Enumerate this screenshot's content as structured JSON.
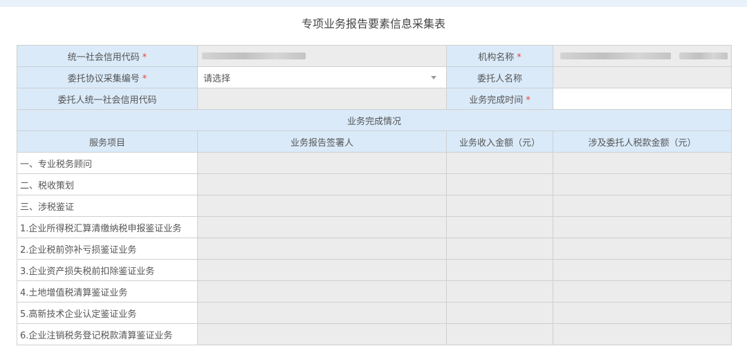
{
  "page": {
    "title": "专项业务报告要素信息采集表"
  },
  "fields": {
    "credit_code_label": "统一社会信用代码",
    "org_name_label": "机构名称",
    "agreement_no_label": "委托协议采集编号",
    "agreement_no_placeholder": "请选择",
    "client_name_label": "委托人名称",
    "client_credit_code_label": "委托人统一社会信用代码",
    "complete_time_label": "业务完成时间",
    "required_mark": "*"
  },
  "section": {
    "title": "业务完成情况"
  },
  "table": {
    "headers": [
      "服务项目",
      "业务报告签署人",
      "业务收入金额（元）",
      "涉及委托人税款金额（元）"
    ],
    "rows": [
      "一、专业税务顾问",
      "二、税收策划",
      "三、涉税鉴证",
      "1.企业所得税汇算清缴纳税申报鉴证业务",
      "2.企业税前弥补亏损鉴证业务",
      "3.企业资产损失税前扣除鉴证业务",
      "4.土地增值税清算鉴证业务",
      "5.高新技术企业认定鉴证业务",
      "6.企业注销税务登记税款清算鉴证业务"
    ]
  }
}
